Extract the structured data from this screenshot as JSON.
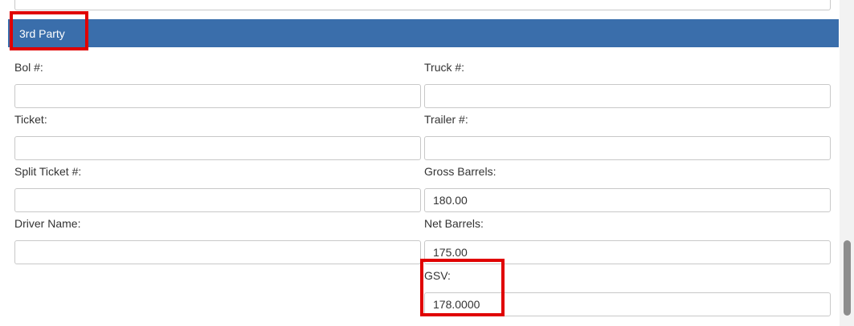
{
  "section": {
    "title": "3rd Party"
  },
  "fields": {
    "bol": {
      "label": "Bol #:",
      "value": ""
    },
    "truck": {
      "label": "Truck #:",
      "value": ""
    },
    "ticket": {
      "label": "Ticket:",
      "value": ""
    },
    "trailer": {
      "label": "Trailer #:",
      "value": ""
    },
    "split_ticket": {
      "label": "Split Ticket #:",
      "value": ""
    },
    "gross_barrels": {
      "label": "Gross Barrels:",
      "value": "180.00"
    },
    "driver_name": {
      "label": "Driver Name:",
      "value": ""
    },
    "net_barrels": {
      "label": "Net Barrels:",
      "value": "175.00"
    },
    "gsv": {
      "label": "GSV:",
      "value": "178.0000"
    }
  },
  "colors": {
    "header_bg": "#3a6eab",
    "highlight": "#e00000"
  }
}
